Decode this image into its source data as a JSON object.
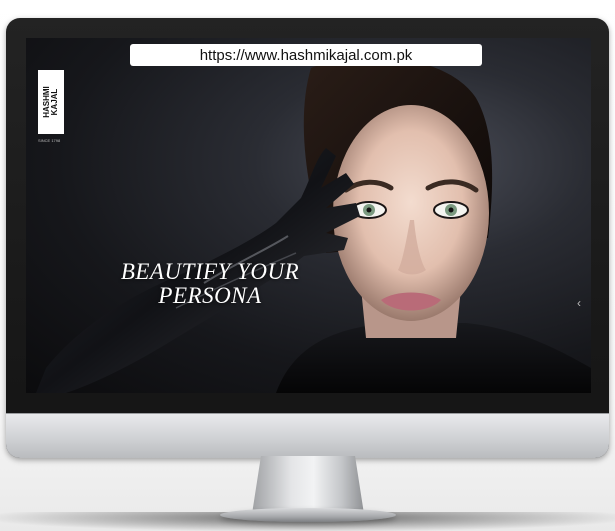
{
  "browser": {
    "url": "https://www.hashmikajal.com.pk"
  },
  "brand": {
    "line1": "HASHMI",
    "line2": "KAJAL",
    "tagline": "SINCE 1798"
  },
  "hero": {
    "headline_line1": "BEAUTIFY YOUR",
    "headline_line2": "PERSONA"
  },
  "icons": {
    "next": "chevron-right-icon"
  },
  "colors": {
    "background": "#0b0b0d",
    "url_bar": "#ffffff",
    "headline": "#ffffff"
  }
}
